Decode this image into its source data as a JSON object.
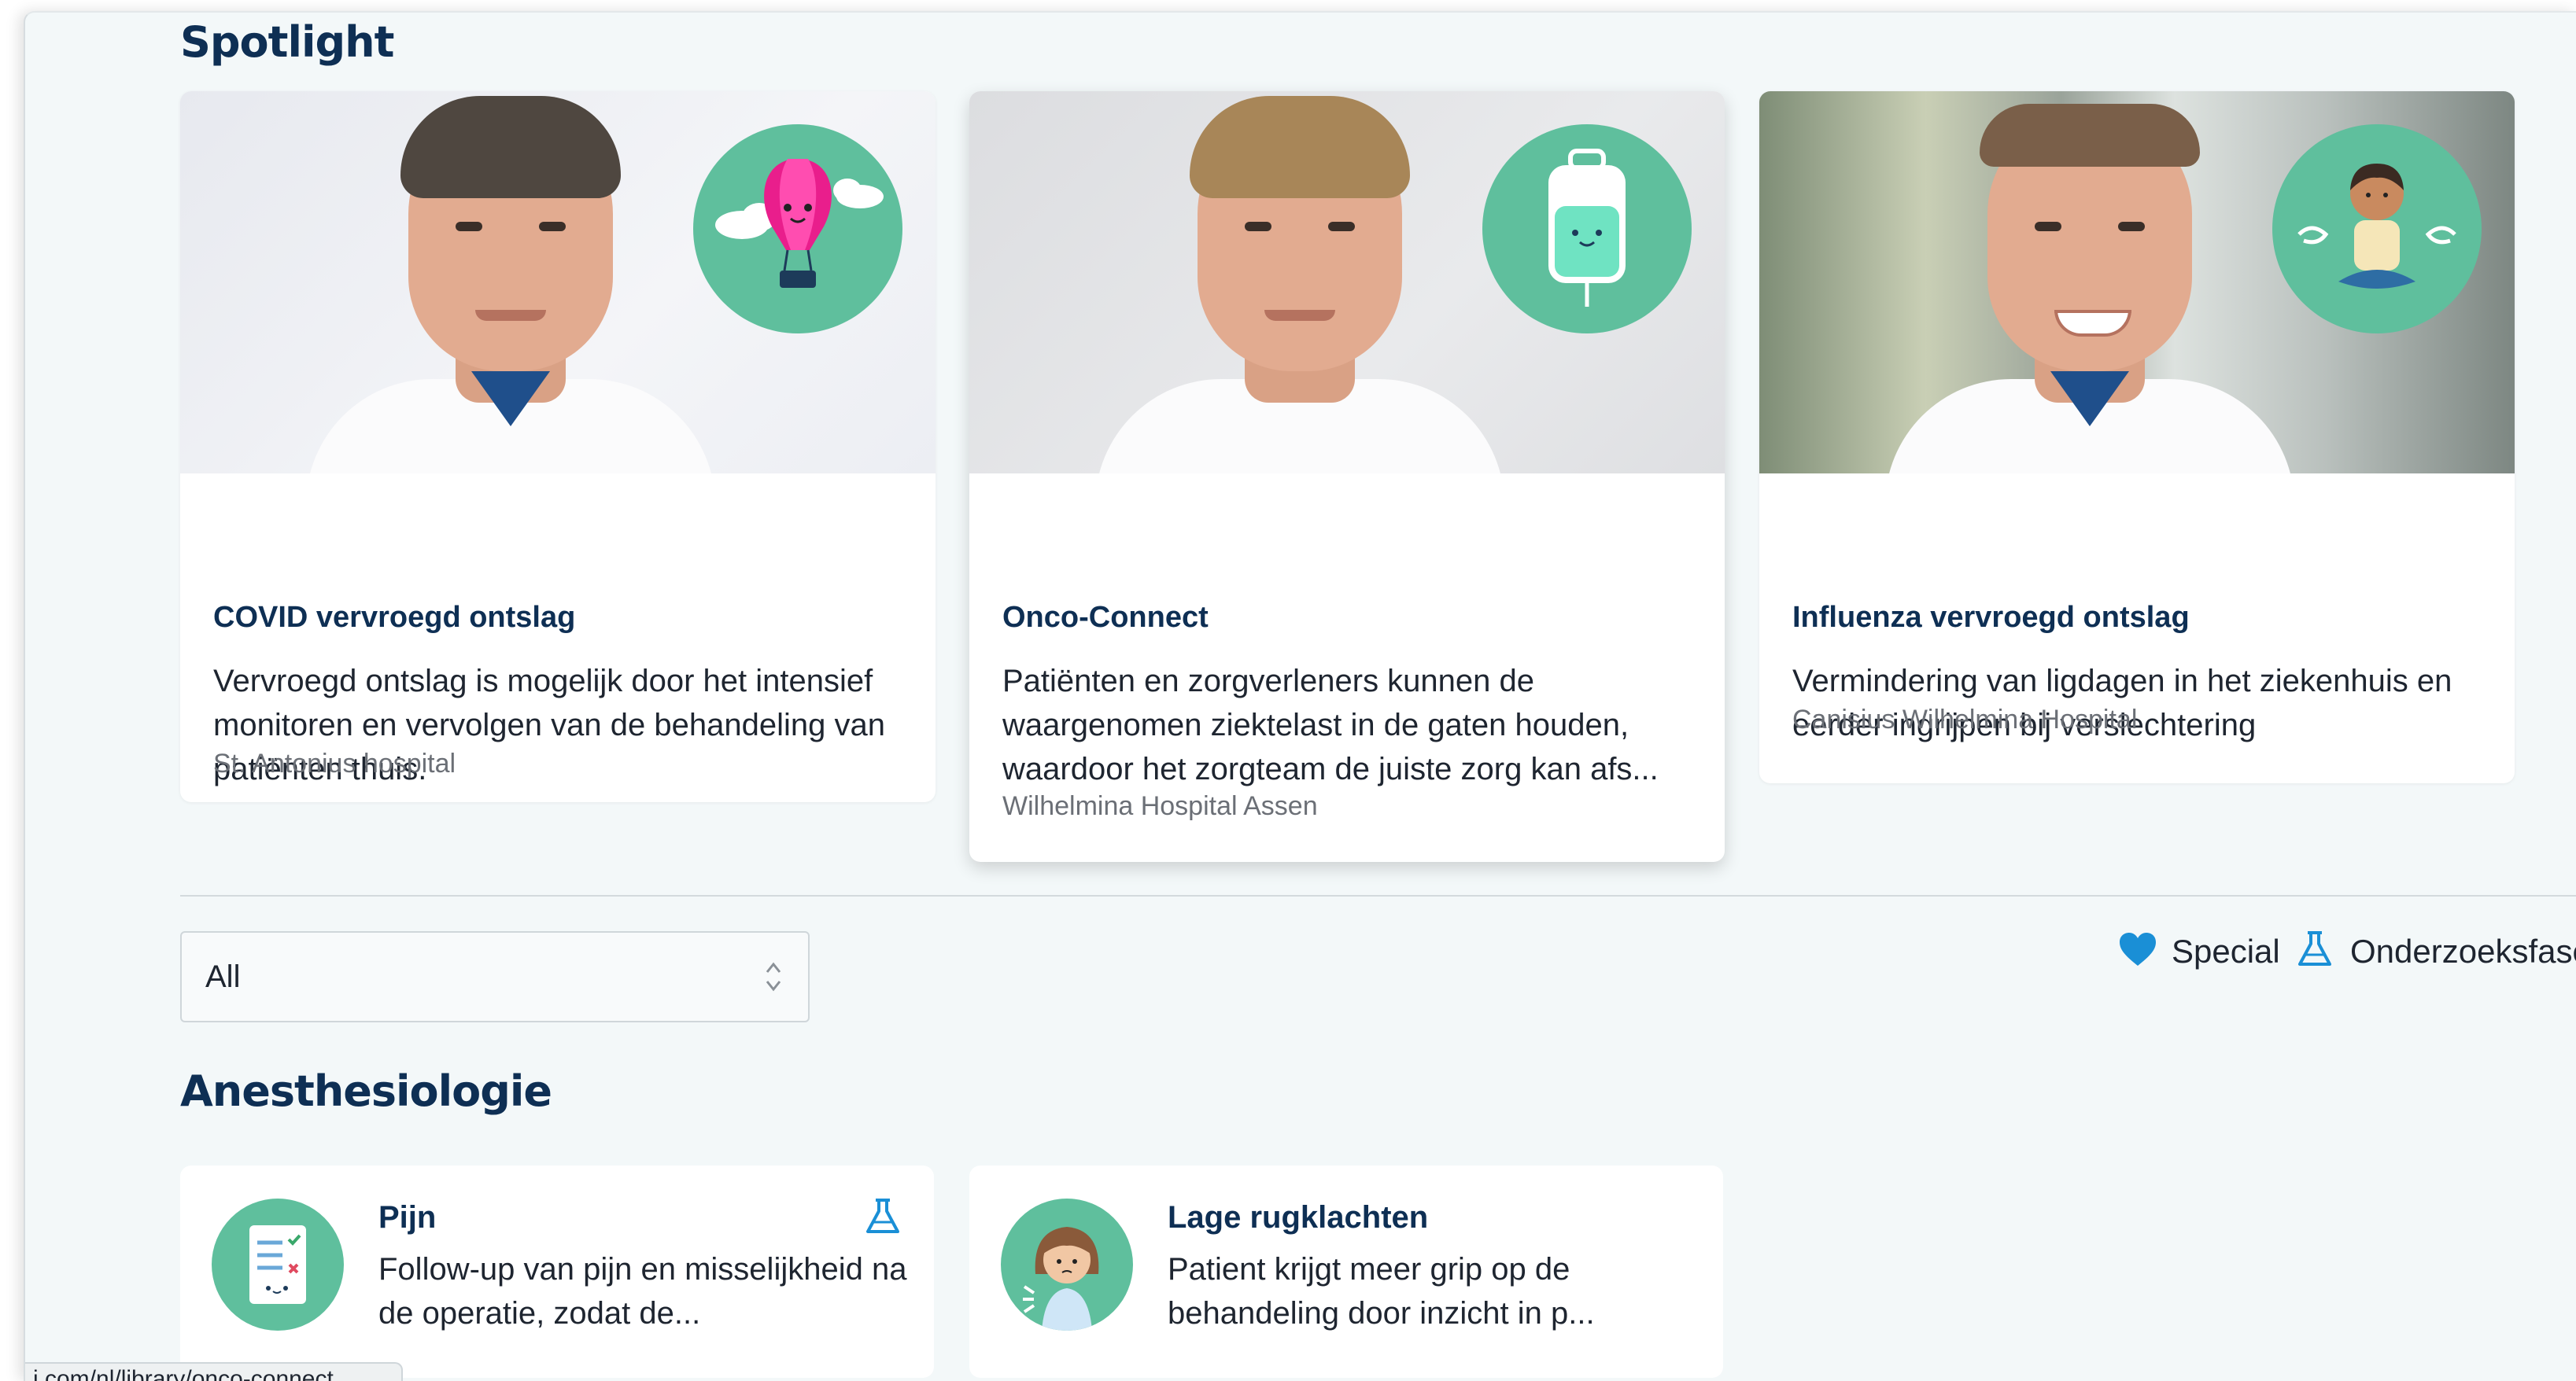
{
  "spotlight": {
    "title": "Spotlight",
    "cards": [
      {
        "title": "COVID vervroegd ontslag",
        "description": "Vervroegd ontslag is mogelijk door het intensief monitoren en vervolgen van de behandeling van patiënten thuis.",
        "source": "St. Antonius hospital",
        "badge_icon": "hot-air-balloon-icon"
      },
      {
        "title": "Onco-Connect",
        "description": "Patiënten en zorgverleners kunnen de waargenomen ziektelast in de gaten houden, waardoor het zorgteam de juiste zorg kan afs...",
        "source": "Wilhelmina Hospital Assen",
        "badge_icon": "iv-bag-icon"
      },
      {
        "title": "Influenza vervroegd ontslag",
        "description": "Vermindering van ligdagen in het ziekenhuis en eerder ingrijpen bij verslechtering",
        "source": "Canisius Wilhelmina Hospital",
        "badge_icon": "meditating-person-icon"
      }
    ]
  },
  "filter": {
    "selected": "All"
  },
  "legend": {
    "special_label": "Special",
    "research_label": "Onderzoeksfase",
    "special_icon": "heart-icon",
    "research_icon": "flask-icon"
  },
  "anesthesiology": {
    "title": "Anesthesiologie",
    "cards": [
      {
        "title": "Pijn",
        "description": "Follow-up van pijn en misselijkheid na de operatie, zodat de...",
        "icon": "checklist-icon",
        "flag_icon": "flask-icon"
      },
      {
        "title": "Lage rugklachten",
        "description": "Patient krijgt meer grip op de behandeling door inzicht in p...",
        "icon": "back-pain-avatar-icon"
      }
    ]
  },
  "status_bar": {
    "url": "i.com/nl/library/onco-connect"
  },
  "colors": {
    "navy": "#0e2f54",
    "teal": "#5fbf9d",
    "accent_blue": "#1a8fd6",
    "background": "#f3f8f9"
  }
}
